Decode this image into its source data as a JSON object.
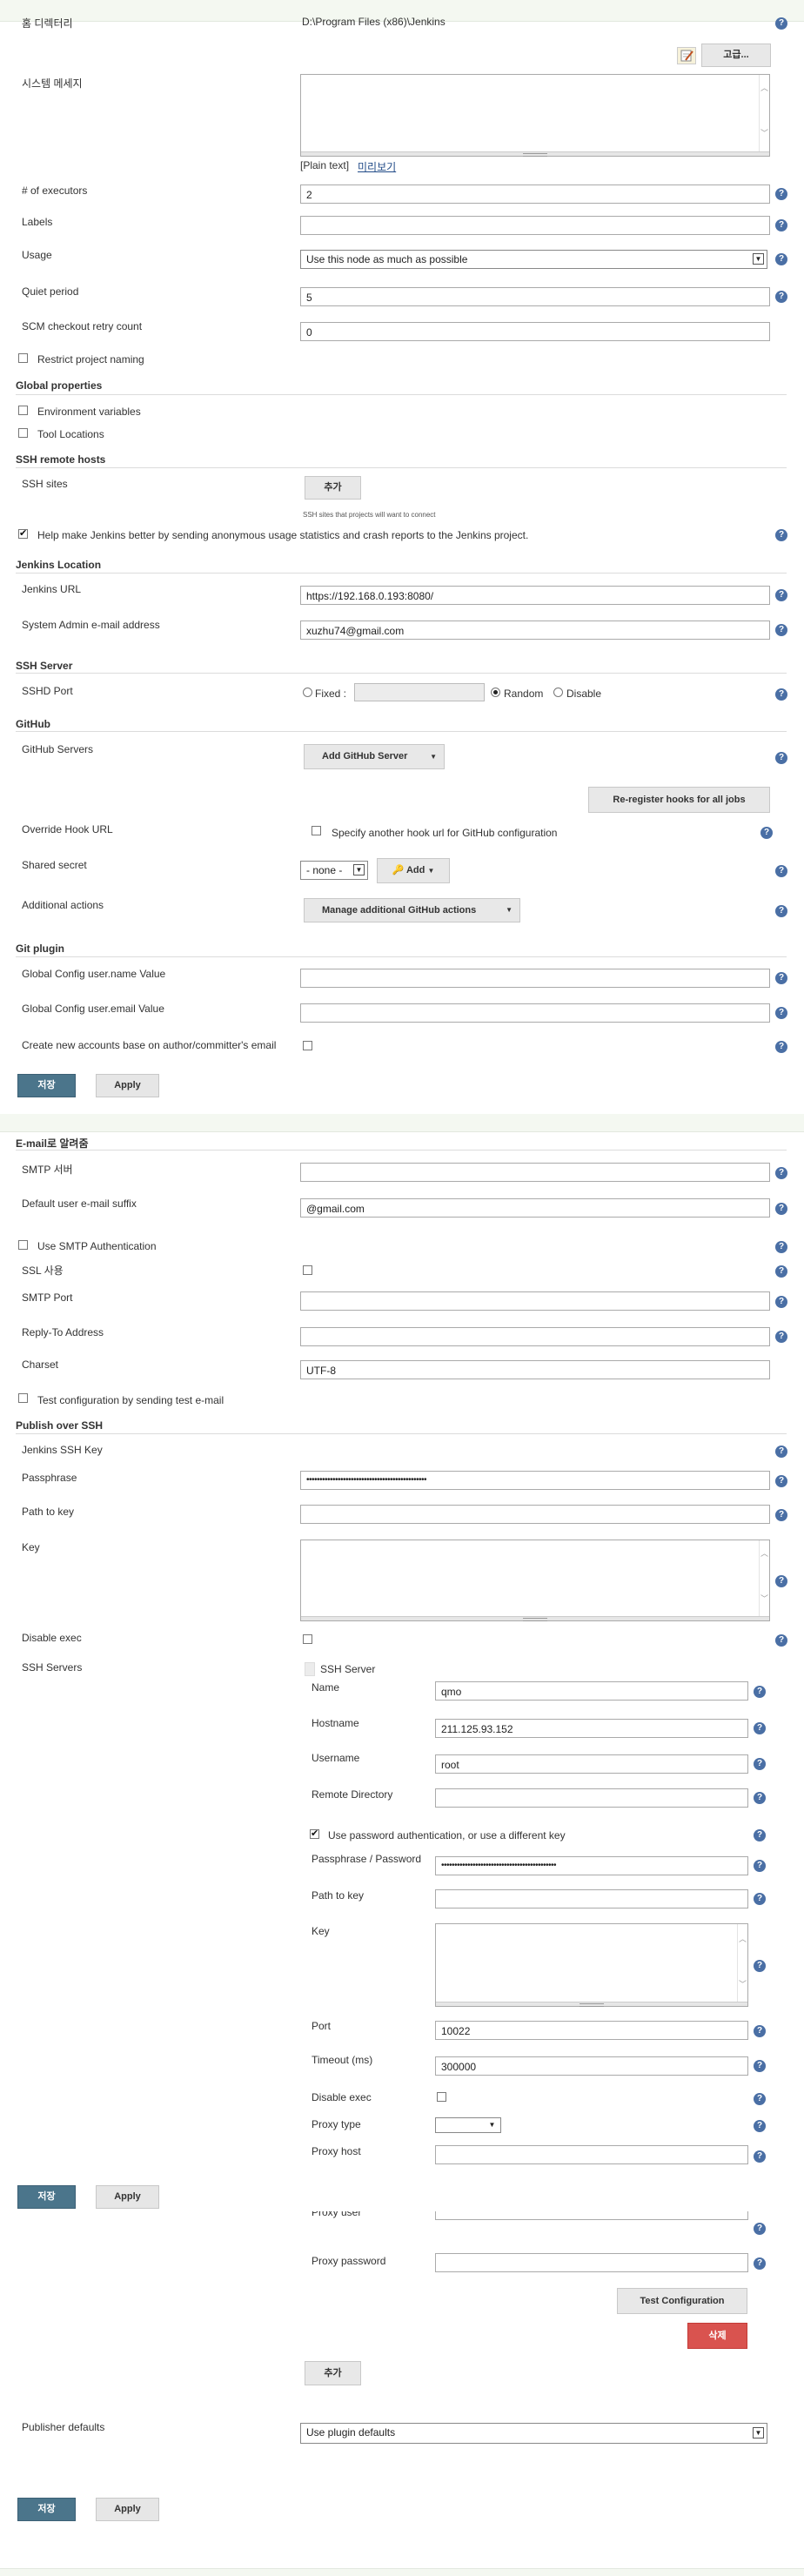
{
  "top": {
    "home_label": "홈 디렉터리",
    "home_value": "D:\\Program Files (x86)\\Jenkins",
    "advanced": "고급..."
  },
  "system_message": {
    "label": "시스템 메세지",
    "plain_text": "[Plain text]",
    "preview": "미리보기"
  },
  "executors": {
    "label": "# of executors",
    "value": "2"
  },
  "labels": {
    "label": "Labels",
    "value": ""
  },
  "usage": {
    "label": "Usage",
    "value": "Use this node as much as possible"
  },
  "quiet": {
    "label": "Quiet period",
    "value": "5"
  },
  "scm": {
    "label": "SCM checkout retry count",
    "value": "0"
  },
  "restrict": {
    "label": "Restrict project naming"
  },
  "global_props": {
    "title": "Global properties",
    "env": "Environment variables",
    "tools": "Tool Locations"
  },
  "ssh_remote": {
    "title": "SSH remote hosts",
    "label": "SSH sites",
    "add": "추가",
    "note": "SSH sites that projects will want to connect"
  },
  "usage_stats": {
    "label": "Help make Jenkins better by sending anonymous usage statistics and crash reports to the Jenkins project."
  },
  "location": {
    "title": "Jenkins Location",
    "url_label": "Jenkins URL",
    "url": "https://192.168.0.193:8080/",
    "email_label": "System Admin e-mail address",
    "email": "xuzhu74@gmail.com"
  },
  "ssh_server": {
    "title": "SSH Server",
    "port_label": "SSHD Port",
    "fixed": "Fixed :",
    "random": "Random",
    "disable": "Disable"
  },
  "github": {
    "title": "GitHub",
    "servers_label": "GitHub Servers",
    "add_server": "Add GitHub Server",
    "rereg": "Re-register hooks for all jobs",
    "override_label": "Override Hook URL",
    "override_cb": "Specify another hook url for GitHub configuration",
    "secret_label": "Shared secret",
    "secret_value": "- none -",
    "add": "Add",
    "actions_label": "Additional actions",
    "manage": "Manage additional GitHub actions"
  },
  "git": {
    "title": "Git plugin",
    "name_label": "Global Config user.name Value",
    "email_label": "Global Config user.email Value",
    "create_label": "Create new accounts base on author/committer's email"
  },
  "buttons": {
    "save": "저장",
    "apply": "Apply"
  },
  "email": {
    "title": "E-mail로 알려줌",
    "smtp_label": "SMTP 서버",
    "suffix_label": "Default user e-mail suffix",
    "suffix": "@gmail.com",
    "auth": "Use SMTP Authentication",
    "ssl": "SSL 사용",
    "port_label": "SMTP Port",
    "reply_label": "Reply-To Address",
    "charset_label": "Charset",
    "charset": "UTF-8",
    "test": "Test configuration by sending test e-mail"
  },
  "publish": {
    "title": "Publish over SSH",
    "key_label": "Jenkins SSH Key",
    "pass_label": "Passphrase",
    "pass_value": "••••••••••••••••••••••••••••••••••••••••••••••",
    "path_label": "Path to key",
    "keytext_label": "Key",
    "disable_label": "Disable exec",
    "servers_label": "SSH Servers"
  },
  "server": {
    "header": "SSH Server",
    "name_label": "Name",
    "name": "qmo",
    "host_label": "Hostname",
    "host": "211.125.93.152",
    "user_label": "Username",
    "user": "root",
    "dir_label": "Remote Directory",
    "usepw": "Use password authentication, or use a different key",
    "pp_label": "Passphrase / Password",
    "pp_value": "••••••••••••••••••••••••••••••••••••••••••••",
    "path_label": "Path to key",
    "key_label": "Key",
    "port_label": "Port",
    "port": "10022",
    "timeout_label": "Timeout (ms)",
    "timeout": "300000",
    "disable_label": "Disable exec",
    "proxytype_label": "Proxy type",
    "proxyhost_label": "Proxy host",
    "proxyuser_label": "Proxy user",
    "proxypw_label": "Proxy password",
    "testcfg": "Test Configuration",
    "delete": "삭제",
    "add": "추가"
  },
  "defaults": {
    "label": "Publisher defaults",
    "value": "Use plugin defaults"
  },
  "help": "?"
}
